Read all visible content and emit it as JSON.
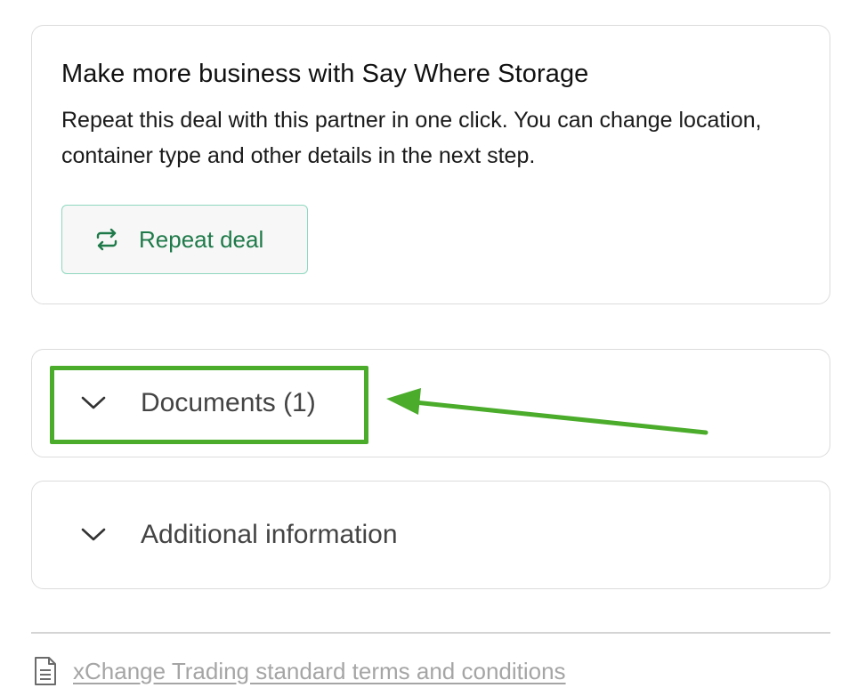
{
  "promo": {
    "title": "Make more business with Say Where Storage",
    "description": "Repeat this deal with this partner in one click. You can change location, container type and other details in the next step.",
    "button_label": "Repeat deal",
    "button_icon": "repeat-icon"
  },
  "accordions": [
    {
      "label": "Documents (1)",
      "icon": "chevron-down-icon"
    },
    {
      "label": "Additional information",
      "icon": "chevron-down-icon"
    }
  ],
  "footer": {
    "terms_link": "xChange Trading standard terms and conditions",
    "terms_icon": "document-icon"
  },
  "colors": {
    "accent_green_text": "#1f7a4a",
    "button_border": "#8fd8c0",
    "annotation_green": "#4aac2a",
    "link_gray": "#a5a5a5"
  }
}
